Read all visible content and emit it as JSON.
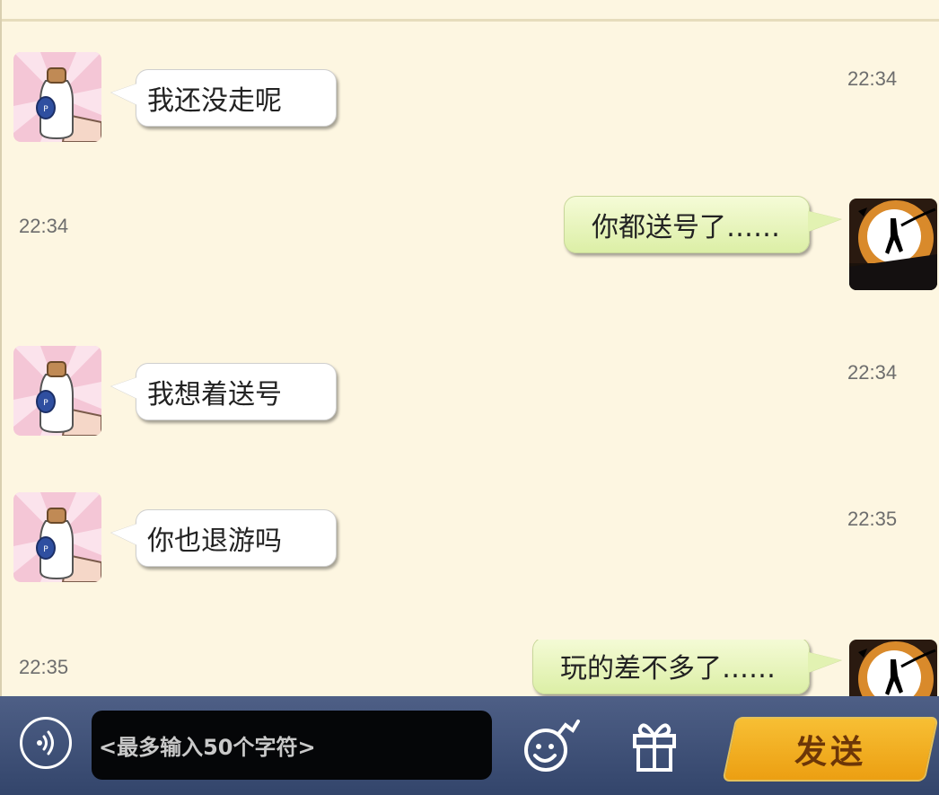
{
  "messages": [
    {
      "direction": "in",
      "text": "我还没走呢",
      "time": "22:34"
    },
    {
      "direction": "out",
      "text": "你都送号了……",
      "time": "22:34"
    },
    {
      "direction": "in",
      "text": "我想着送号",
      "time": "22:34"
    },
    {
      "direction": "in",
      "text": "你也退游吗",
      "time": "22:35"
    },
    {
      "direction": "out",
      "text": "玩的差不多了……",
      "time": "22:35"
    }
  ],
  "composer": {
    "placeholder": "<最多输入50个字符>",
    "send_label": "发送",
    "voice_icon": "voice-icon",
    "emoji_icon": "emoji-icon",
    "gift_icon": "gift-icon"
  },
  "avatars": {
    "contact": "milk-bottle-avatar",
    "self": "silhouette-moon-avatar"
  },
  "colors": {
    "background": "#fdf6e1",
    "incoming_bubble": "#ffffff",
    "outgoing_bubble": "#dcefa6",
    "bottom_bar": "#3d4f76",
    "send_button": "#f2ae22",
    "send_text": "#6c3608"
  }
}
